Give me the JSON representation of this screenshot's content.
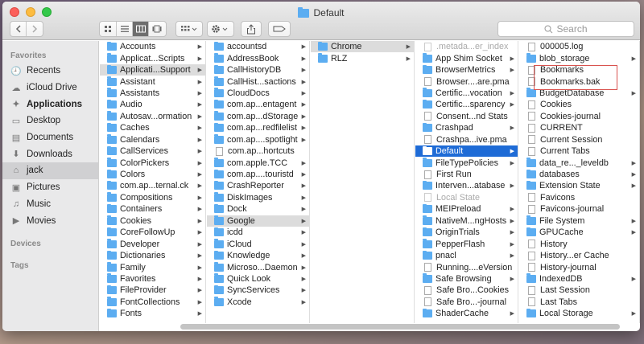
{
  "window": {
    "title": "Default"
  },
  "toolbar": {
    "search_placeholder": "Search"
  },
  "sidebar": {
    "sections": [
      {
        "header": "Favorites",
        "items": [
          {
            "label": "Recents",
            "icon": "clock-icon"
          },
          {
            "label": "iCloud Drive",
            "icon": "cloud-icon"
          },
          {
            "label": "Applications",
            "icon": "applications-icon",
            "bold": true
          },
          {
            "label": "Desktop",
            "icon": "desktop-icon"
          },
          {
            "label": "Documents",
            "icon": "documents-icon"
          },
          {
            "label": "Downloads",
            "icon": "downloads-icon"
          },
          {
            "label": "jack",
            "icon": "home-icon",
            "selected": true
          },
          {
            "label": "Pictures",
            "icon": "pictures-icon"
          },
          {
            "label": "Music",
            "icon": "music-icon"
          },
          {
            "label": "Movies",
            "icon": "movies-icon"
          }
        ]
      },
      {
        "header": "Devices",
        "items": []
      },
      {
        "header": "Tags",
        "items": []
      }
    ]
  },
  "columns": [
    {
      "items": [
        {
          "label": "Accounts",
          "type": "folder"
        },
        {
          "label": "Applicat...Scripts",
          "type": "folder"
        },
        {
          "label": "Applicati...Support",
          "type": "folder",
          "state": "hl"
        },
        {
          "label": "Assistant",
          "type": "folder"
        },
        {
          "label": "Assistants",
          "type": "folder"
        },
        {
          "label": "Audio",
          "type": "folder"
        },
        {
          "label": "Autosav...ormation",
          "type": "folder"
        },
        {
          "label": "Caches",
          "type": "folder"
        },
        {
          "label": "Calendars",
          "type": "folder"
        },
        {
          "label": "CallServices",
          "type": "folder"
        },
        {
          "label": "ColorPickers",
          "type": "folder"
        },
        {
          "label": "Colors",
          "type": "folder"
        },
        {
          "label": "com.ap...ternal.ck",
          "type": "folder"
        },
        {
          "label": "Compositions",
          "type": "folder"
        },
        {
          "label": "Containers",
          "type": "folder"
        },
        {
          "label": "Cookies",
          "type": "folder"
        },
        {
          "label": "CoreFollowUp",
          "type": "folder"
        },
        {
          "label": "Developer",
          "type": "folder"
        },
        {
          "label": "Dictionaries",
          "type": "folder"
        },
        {
          "label": "Family",
          "type": "folder"
        },
        {
          "label": "Favorites",
          "type": "folder"
        },
        {
          "label": "FileProvider",
          "type": "folder"
        },
        {
          "label": "FontCollections",
          "type": "folder"
        },
        {
          "label": "Fonts",
          "type": "folder"
        }
      ]
    },
    {
      "items": [
        {
          "label": "accountsd",
          "type": "folder"
        },
        {
          "label": "AddressBook",
          "type": "folder"
        },
        {
          "label": "CallHistoryDB",
          "type": "folder"
        },
        {
          "label": "CallHist...sactions",
          "type": "folder"
        },
        {
          "label": "CloudDocs",
          "type": "folder"
        },
        {
          "label": "com.ap...entagent",
          "type": "folder"
        },
        {
          "label": "com.ap...dStorage",
          "type": "folder"
        },
        {
          "label": "com.ap...redfilelist",
          "type": "folder"
        },
        {
          "label": "com.ap....spotlight",
          "type": "folder"
        },
        {
          "label": "com.ap...hortcuts",
          "type": "file"
        },
        {
          "label": "com.apple.TCC",
          "type": "folder"
        },
        {
          "label": "com.ap....touristd",
          "type": "folder"
        },
        {
          "label": "CrashReporter",
          "type": "folder"
        },
        {
          "label": "DiskImages",
          "type": "folder"
        },
        {
          "label": "Dock",
          "type": "folder"
        },
        {
          "label": "Google",
          "type": "folder",
          "state": "hl"
        },
        {
          "label": "icdd",
          "type": "folder"
        },
        {
          "label": "iCloud",
          "type": "folder"
        },
        {
          "label": "Knowledge",
          "type": "folder"
        },
        {
          "label": "Microso...Daemon",
          "type": "folder"
        },
        {
          "label": "Quick Look",
          "type": "folder"
        },
        {
          "label": "SyncServices",
          "type": "folder"
        },
        {
          "label": "Xcode",
          "type": "folder"
        }
      ]
    },
    {
      "items": [
        {
          "label": "Chrome",
          "type": "folder",
          "state": "hl"
        },
        {
          "label": "RLZ",
          "type": "folder"
        }
      ]
    },
    {
      "items": [
        {
          "label": ".metada...er_index",
          "type": "file",
          "state": "dim"
        },
        {
          "label": "App Shim Socket",
          "type": "folder"
        },
        {
          "label": "BrowserMetrics",
          "type": "folder"
        },
        {
          "label": "Browser....are.pma",
          "type": "file"
        },
        {
          "label": "Certific...vocation",
          "type": "folder"
        },
        {
          "label": "Certific...sparency",
          "type": "folder"
        },
        {
          "label": "Consent...nd Stats",
          "type": "file"
        },
        {
          "label": "Crashpad",
          "type": "folder"
        },
        {
          "label": "Crashpa...ive.pma",
          "type": "file"
        },
        {
          "label": "Default",
          "type": "folder",
          "state": "sel"
        },
        {
          "label": "FileTypePolicies",
          "type": "folder"
        },
        {
          "label": "First Run",
          "type": "file"
        },
        {
          "label": "Interven...atabase",
          "type": "folder"
        },
        {
          "label": "Local State",
          "type": "file",
          "state": "dim"
        },
        {
          "label": "MEIPreload",
          "type": "folder"
        },
        {
          "label": "NativeM...ngHosts",
          "type": "folder"
        },
        {
          "label": "OriginTrials",
          "type": "folder"
        },
        {
          "label": "PepperFlash",
          "type": "folder"
        },
        {
          "label": "pnacl",
          "type": "folder"
        },
        {
          "label": "Running....eVersion",
          "type": "file"
        },
        {
          "label": "Safe Browsing",
          "type": "folder"
        },
        {
          "label": "Safe Bro...Cookies",
          "type": "file"
        },
        {
          "label": "Safe Bro...-journal",
          "type": "file"
        },
        {
          "label": "ShaderCache",
          "type": "folder"
        }
      ]
    },
    {
      "items": [
        {
          "label": "000005.log",
          "type": "file"
        },
        {
          "label": "blob_storage",
          "type": "folder"
        },
        {
          "label": "Bookmarks",
          "type": "file"
        },
        {
          "label": "Bookmarks.bak",
          "type": "file"
        },
        {
          "label": "BudgetDatabase",
          "type": "folder"
        },
        {
          "label": "Cookies",
          "type": "file"
        },
        {
          "label": "Cookies-journal",
          "type": "file"
        },
        {
          "label": "CURRENT",
          "type": "file"
        },
        {
          "label": "Current Session",
          "type": "file"
        },
        {
          "label": "Current Tabs",
          "type": "file"
        },
        {
          "label": "data_re..._leveldb",
          "type": "folder"
        },
        {
          "label": "databases",
          "type": "folder"
        },
        {
          "label": "Extension State",
          "type": "folder"
        },
        {
          "label": "Favicons",
          "type": "file"
        },
        {
          "label": "Favicons-journal",
          "type": "file"
        },
        {
          "label": "File System",
          "type": "folder"
        },
        {
          "label": "GPUCache",
          "type": "folder"
        },
        {
          "label": "History",
          "type": "file"
        },
        {
          "label": "History...er Cache",
          "type": "file"
        },
        {
          "label": "History-journal",
          "type": "file"
        },
        {
          "label": "IndexedDB",
          "type": "folder"
        },
        {
          "label": "Last Session",
          "type": "file"
        },
        {
          "label": "Last Tabs",
          "type": "file"
        },
        {
          "label": "Local Storage",
          "type": "folder"
        }
      ]
    }
  ]
}
